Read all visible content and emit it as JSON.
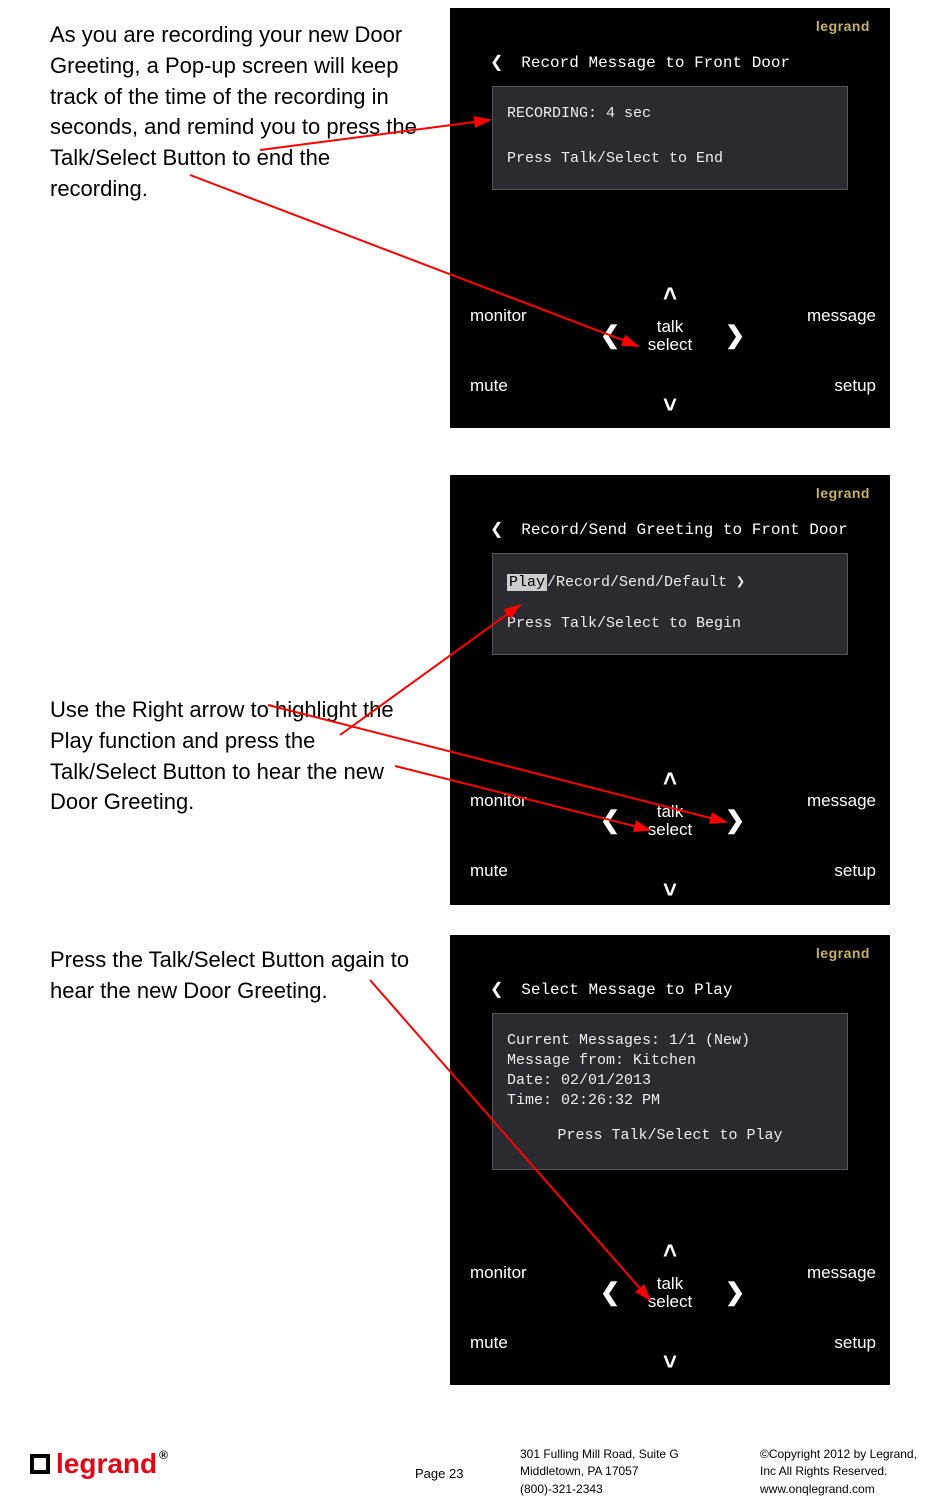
{
  "captions": {
    "c1": "As you are recording your new Door Greeting, a Pop-up screen will keep track of the time of the recording in seconds, and remind you to press the Talk/Select Button to end the recording.",
    "c2": "Use the Right arrow to highlight the Play function and press the Talk/Select Button to hear the new Door Greeting.",
    "c3": "Press the Talk/Select Button again to hear the new Door Greeting."
  },
  "brand": "legrand",
  "device1": {
    "title": "Record Message to Front Door",
    "popup_line1": "RECORDING: 4 sec",
    "popup_line2": "Press Talk/Select to End"
  },
  "device2": {
    "title": "Record/Send Greeting to Front Door",
    "highlight": "Play",
    "options_rest": "/Record/Send/Default ❯",
    "begin": "Press Talk/Select to Begin"
  },
  "device3": {
    "title": "Select Message to Play",
    "current": "Current Messages: 1/1 (New)",
    "from": "Message from: Kitchen",
    "date": "Date: 02/01/2013",
    "time": "Time: 02:26:32 PM",
    "play": "Press Talk/Select to Play"
  },
  "controls": {
    "monitor": "monitor",
    "message": "message",
    "mute": "mute",
    "setup": "setup",
    "talk": "talk",
    "select": "select"
  },
  "chevrons": {
    "left": "❮",
    "right": "❯",
    "up": "˄",
    "down": "˅"
  },
  "footer": {
    "page_label": "Page ",
    "page_num": "23",
    "addr1": "301 Fulling Mill Road, Suite G",
    "addr2": "Middletown, PA   17057",
    "phone": "(800)-321-2343",
    "copy1": "©Copyright 2012 by Legrand,",
    "copy2": "Inc All Rights Reserved.",
    "url": "www.onqlegrand.com",
    "logo_text": "legrand"
  }
}
